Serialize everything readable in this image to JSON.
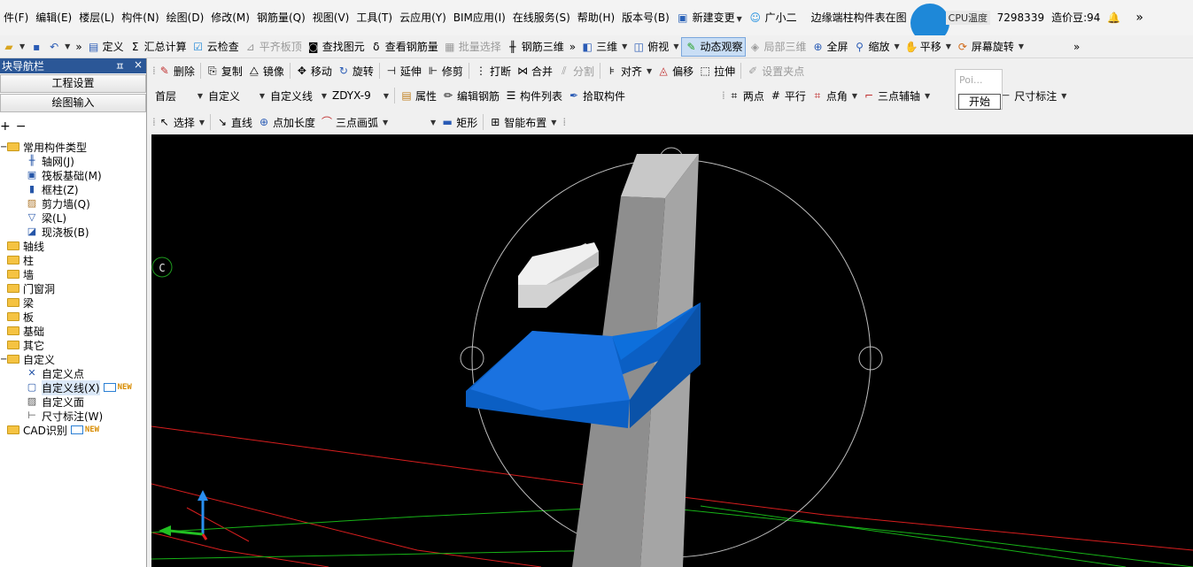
{
  "menubar": {
    "items": [
      "件(F)",
      "编辑(E)",
      "楼层(L)",
      "构件(N)",
      "绘图(D)",
      "修改(M)",
      "钢筋量(Q)",
      "视图(V)",
      "工具(T)",
      "云应用(Y)",
      "BIM应用(I)",
      "在线服务(S)",
      "帮助(H)",
      "版本号(B)"
    ],
    "new_change": "新建变更",
    "assistant": "广小二",
    "notice": "边缘端柱构件表在图",
    "cpu_label": "CPU温度",
    "account_id": "7298339",
    "beans": "造价豆:94",
    "overflow": "»"
  },
  "toolbar1": {
    "define": "定义",
    "calc": "汇总计算",
    "cloud_check": "云检查",
    "flush_top": "平齐板顶",
    "find_elem": "查找图元",
    "view_rebar": "查看钢筋量",
    "batch_select": "批量选择",
    "rebar_3d": "钢筋三维",
    "three_d": "三维",
    "top_view": "俯视",
    "dynamic": "动态观察",
    "local_3d": "局部三维",
    "fullscreen": "全屏",
    "zoom": "缩放",
    "pan": "平移",
    "rotate_screen": "屏幕旋转"
  },
  "edit_toolbar": {
    "delete": "删除",
    "copy": "复制",
    "mirror": "镜像",
    "move": "移动",
    "rotate": "旋转",
    "extend": "延伸",
    "trim": "修剪",
    "break": "打断",
    "merge": "合并",
    "split": "分割",
    "align": "对齐",
    "offset": "偏移",
    "stretch": "拉伸",
    "set_grip": "设置夹点"
  },
  "prop_toolbar": {
    "floor": "首层",
    "category": "自定义",
    "type": "自定义线",
    "name": "ZDYX-9",
    "attributes": "属性",
    "edit_rebar": "编辑钢筋",
    "comp_list": "构件列表",
    "pick_comp": "拾取构件"
  },
  "axis_toolbar": {
    "two_point": "两点",
    "parallel": "平行",
    "point_angle": "点角",
    "three_point_axis": "三点辅轴",
    "axis_fragment": "轴",
    "dimension": "尺寸标注"
  },
  "draw_toolbar": {
    "select": "选择",
    "line": "直线",
    "point_length": "点加长度",
    "arc3": "三点画弧",
    "rect": "矩形",
    "smart_layout": "智能布置"
  },
  "popup": {
    "placeholder": "Poi...",
    "start": "开始"
  },
  "nav": {
    "title": "块导航栏",
    "pin": "ㅍ",
    "close": "×",
    "btn_project": "工程设置",
    "btn_draw": "绘图输入",
    "common_types": "常用构件类型",
    "common_children": [
      {
        "label": "轴网(J)",
        "icon": "grid-icon"
      },
      {
        "label": "筏板基础(M)",
        "icon": "raft-icon"
      },
      {
        "label": "框柱(Z)",
        "icon": "column-icon"
      },
      {
        "label": "剪力墙(Q)",
        "icon": "wall-icon"
      },
      {
        "label": "梁(L)",
        "icon": "beam-icon"
      },
      {
        "label": "现浇板(B)",
        "icon": "slab-icon"
      }
    ],
    "folders": [
      "轴线",
      "柱",
      "墙",
      "门窗洞",
      "梁",
      "板",
      "基础",
      "其它"
    ],
    "custom": "自定义",
    "custom_children": [
      {
        "label": "自定义点",
        "icon": "point-icon"
      },
      {
        "label": "自定义线(X)",
        "icon": "line-icon",
        "new": "NEW"
      },
      {
        "label": "自定义面",
        "icon": "face-icon"
      },
      {
        "label": "尺寸标注(W)",
        "icon": "dimension-icon"
      }
    ],
    "cad": "CAD识别",
    "cad_new": "NEW"
  },
  "viewport": {
    "axis_label": "C",
    "colors": {
      "beam": "#0d6fdc",
      "column": "#9a9a9a",
      "block": "#e8e8e8",
      "red": "#d81e1e",
      "green": "#17b317"
    }
  }
}
